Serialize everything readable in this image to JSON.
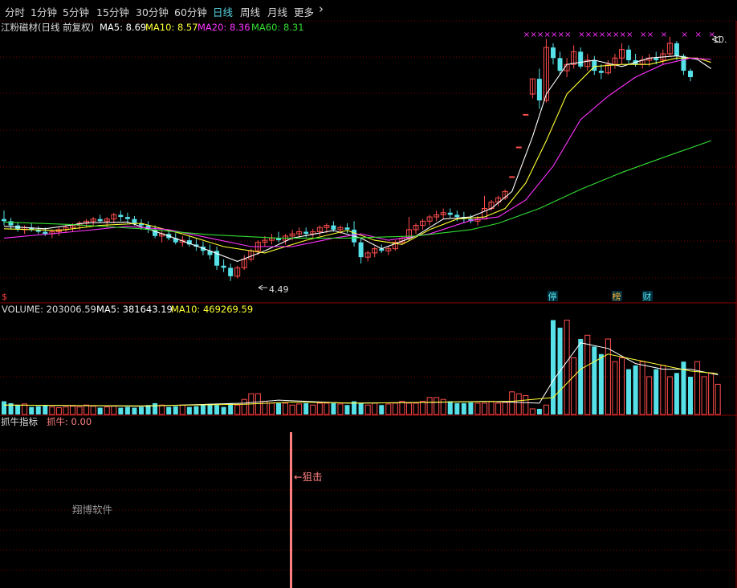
{
  "tabs": [
    {
      "label": "分时",
      "active": false
    },
    {
      "label": "1分钟",
      "active": false
    },
    {
      "label": "5分钟",
      "active": false
    },
    {
      "label": "15分钟",
      "active": false
    },
    {
      "label": "30分钟",
      "active": false
    },
    {
      "label": "60分钟",
      "active": false
    },
    {
      "label": "日线",
      "active": true
    },
    {
      "label": "周线",
      "active": false
    },
    {
      "label": "月线",
      "active": false
    },
    {
      "label": "更多",
      "active": false
    }
  ],
  "more_icon": "chevron-right-icon",
  "colors": {
    "background": "#000000",
    "grid": "#7a0000",
    "axis": "#8b0000",
    "up": "#ff4d4d",
    "down": "#56e0e8",
    "ma5": "#ffffff",
    "ma10": "#ffff33",
    "ma20": "#ff33ff",
    "ma60": "#33dd33",
    "marker": "#ff33ff",
    "signal": "#ff8080",
    "tab_active": "#57d7e3"
  },
  "price_panel": {
    "title": "江粉磁材(日线 前复权)",
    "ma_labels": [
      {
        "text": "MA5: 8.69",
        "color": "#ffffff"
      },
      {
        "text": "MA10: 8.57",
        "color": "#ffff33"
      },
      {
        "text": "MA20: 8.36",
        "color": "#ff33ff"
      },
      {
        "text": "MA60: 8.31",
        "color": "#33dd33"
      }
    ],
    "high_label": "10.",
    "low_label": "4.49",
    "corner_mark": "$",
    "badges": [
      {
        "text": "停",
        "color": "#56e0e8"
      },
      {
        "text": "榜",
        "color": "#ffb030"
      },
      {
        "text": "财",
        "color": "#56e0e8"
      }
    ]
  },
  "volume_panel": {
    "labels": [
      {
        "text": "VOLUME: 203006.59",
        "color": "#dddddd"
      },
      {
        "text": "MA5: 381643.19",
        "color": "#ffffff"
      },
      {
        "text": "MA10: 469269.59",
        "color": "#ffff33"
      }
    ]
  },
  "indicator_panel": {
    "labels": [
      {
        "text": "抓牛指标",
        "color": "#dddddd"
      },
      {
        "text": "抓牛: 0.00",
        "color": "#ff8080"
      }
    ],
    "signal_label": "←狙击",
    "watermark": "翔博软件"
  },
  "chart_data": {
    "type": "candlestick",
    "y_range": [
      4.2,
      10.4
    ],
    "low": 4.49,
    "high_label": "10.",
    "candles": [
      {
        "o": 5.95,
        "h": 6.15,
        "l": 5.8,
        "c": 5.9
      },
      {
        "o": 5.9,
        "h": 5.98,
        "l": 5.7,
        "c": 5.8
      },
      {
        "o": 5.8,
        "h": 5.88,
        "l": 5.65,
        "c": 5.7
      },
      {
        "o": 5.7,
        "h": 5.8,
        "l": 5.6,
        "c": 5.75
      },
      {
        "o": 5.75,
        "h": 5.85,
        "l": 5.65,
        "c": 5.7
      },
      {
        "o": 5.7,
        "h": 5.78,
        "l": 5.6,
        "c": 5.65
      },
      {
        "o": 5.65,
        "h": 5.75,
        "l": 5.55,
        "c": 5.6
      },
      {
        "o": 5.6,
        "h": 5.7,
        "l": 5.5,
        "c": 5.65
      },
      {
        "o": 5.65,
        "h": 5.75,
        "l": 5.55,
        "c": 5.7
      },
      {
        "o": 5.7,
        "h": 5.82,
        "l": 5.62,
        "c": 5.75
      },
      {
        "o": 5.75,
        "h": 5.85,
        "l": 5.66,
        "c": 5.8
      },
      {
        "o": 5.8,
        "h": 5.9,
        "l": 5.7,
        "c": 5.85
      },
      {
        "o": 5.85,
        "h": 5.95,
        "l": 5.75,
        "c": 5.9
      },
      {
        "o": 5.9,
        "h": 6.0,
        "l": 5.8,
        "c": 5.95
      },
      {
        "o": 5.95,
        "h": 6.05,
        "l": 5.85,
        "c": 5.9
      },
      {
        "o": 5.9,
        "h": 6.0,
        "l": 5.75,
        "c": 5.95
      },
      {
        "o": 5.95,
        "h": 6.1,
        "l": 5.85,
        "c": 6.05
      },
      {
        "o": 6.05,
        "h": 6.15,
        "l": 5.9,
        "c": 6.0
      },
      {
        "o": 6.0,
        "h": 6.1,
        "l": 5.85,
        "c": 5.95
      },
      {
        "o": 5.95,
        "h": 6.02,
        "l": 5.8,
        "c": 5.85
      },
      {
        "o": 5.85,
        "h": 5.95,
        "l": 5.7,
        "c": 5.8
      },
      {
        "o": 5.8,
        "h": 5.9,
        "l": 5.62,
        "c": 5.7
      },
      {
        "o": 5.7,
        "h": 5.8,
        "l": 5.5,
        "c": 5.55
      },
      {
        "o": 5.55,
        "h": 5.68,
        "l": 5.4,
        "c": 5.6
      },
      {
        "o": 5.6,
        "h": 5.7,
        "l": 5.45,
        "c": 5.5
      },
      {
        "o": 5.5,
        "h": 5.62,
        "l": 5.35,
        "c": 5.4
      },
      {
        "o": 5.4,
        "h": 5.55,
        "l": 5.3,
        "c": 5.45
      },
      {
        "o": 5.45,
        "h": 5.55,
        "l": 5.3,
        "c": 5.35
      },
      {
        "o": 5.35,
        "h": 5.48,
        "l": 5.2,
        "c": 5.3
      },
      {
        "o": 5.3,
        "h": 5.42,
        "l": 5.1,
        "c": 5.2
      },
      {
        "o": 5.2,
        "h": 5.35,
        "l": 5.0,
        "c": 5.1
      },
      {
        "o": 5.2,
        "h": 5.3,
        "l": 4.75,
        "c": 4.85
      },
      {
        "o": 4.85,
        "h": 5.0,
        "l": 4.7,
        "c": 4.8
      },
      {
        "o": 4.8,
        "h": 4.9,
        "l": 4.49,
        "c": 4.6
      },
      {
        "o": 4.6,
        "h": 4.85,
        "l": 4.55,
        "c": 4.8
      },
      {
        "o": 4.8,
        "h": 5.1,
        "l": 4.75,
        "c": 5.0
      },
      {
        "o": 5.0,
        "h": 5.25,
        "l": 4.95,
        "c": 5.2
      },
      {
        "o": 5.2,
        "h": 5.45,
        "l": 5.1,
        "c": 5.4
      },
      {
        "o": 5.4,
        "h": 5.55,
        "l": 5.3,
        "c": 5.45
      },
      {
        "o": 5.45,
        "h": 5.6,
        "l": 5.35,
        "c": 5.5
      },
      {
        "o": 5.5,
        "h": 5.65,
        "l": 5.4,
        "c": 5.45
      },
      {
        "o": 5.45,
        "h": 5.6,
        "l": 5.35,
        "c": 5.55
      },
      {
        "o": 5.55,
        "h": 5.7,
        "l": 5.45,
        "c": 5.6
      },
      {
        "o": 5.6,
        "h": 5.75,
        "l": 5.5,
        "c": 5.65
      },
      {
        "o": 5.65,
        "h": 5.75,
        "l": 5.52,
        "c": 5.6
      },
      {
        "o": 5.6,
        "h": 5.72,
        "l": 5.5,
        "c": 5.65
      },
      {
        "o": 5.65,
        "h": 5.8,
        "l": 5.55,
        "c": 5.75
      },
      {
        "o": 5.75,
        "h": 5.85,
        "l": 5.62,
        "c": 5.8
      },
      {
        "o": 5.8,
        "h": 5.9,
        "l": 5.65,
        "c": 5.7
      },
      {
        "o": 5.7,
        "h": 5.8,
        "l": 5.6,
        "c": 5.75
      },
      {
        "o": 5.75,
        "h": 5.85,
        "l": 5.62,
        "c": 5.7
      },
      {
        "o": 5.7,
        "h": 5.9,
        "l": 5.3,
        "c": 5.4
      },
      {
        "o": 5.4,
        "h": 5.5,
        "l": 4.9,
        "c": 5.05
      },
      {
        "o": 5.05,
        "h": 5.2,
        "l": 4.95,
        "c": 5.15
      },
      {
        "o": 5.15,
        "h": 5.3,
        "l": 5.05,
        "c": 5.25
      },
      {
        "o": 5.25,
        "h": 5.35,
        "l": 5.15,
        "c": 5.2
      },
      {
        "o": 5.2,
        "h": 5.32,
        "l": 5.1,
        "c": 5.25
      },
      {
        "o": 5.25,
        "h": 5.45,
        "l": 5.2,
        "c": 5.4
      },
      {
        "o": 5.4,
        "h": 5.55,
        "l": 5.35,
        "c": 5.5
      },
      {
        "o": 5.5,
        "h": 6.0,
        "l": 5.45,
        "c": 5.7
      },
      {
        "o": 5.7,
        "h": 5.85,
        "l": 5.6,
        "c": 5.8
      },
      {
        "o": 5.8,
        "h": 5.95,
        "l": 5.7,
        "c": 5.9
      },
      {
        "o": 5.9,
        "h": 6.05,
        "l": 5.8,
        "c": 6.0
      },
      {
        "o": 6.0,
        "h": 6.15,
        "l": 5.9,
        "c": 6.05
      },
      {
        "o": 6.05,
        "h": 6.2,
        "l": 5.95,
        "c": 6.1
      },
      {
        "o": 6.1,
        "h": 6.2,
        "l": 5.98,
        "c": 6.05
      },
      {
        "o": 6.05,
        "h": 6.15,
        "l": 5.9,
        "c": 6.0
      },
      {
        "o": 6.0,
        "h": 6.12,
        "l": 5.85,
        "c": 5.95
      },
      {
        "o": 5.95,
        "h": 6.05,
        "l": 5.85,
        "c": 5.9
      },
      {
        "o": 5.9,
        "h": 6.02,
        "l": 5.8,
        "c": 5.95
      },
      {
        "o": 5.95,
        "h": 6.5,
        "l": 6.15,
        "c": 6.2
      },
      {
        "o": 6.2,
        "h": 6.4,
        "l": 6.15,
        "c": 6.35
      },
      {
        "o": 6.35,
        "h": 6.5,
        "l": 6.25,
        "c": 6.45
      },
      {
        "o": 6.45,
        "h": 6.65,
        "l": 6.4,
        "c": 6.6
      },
      {
        "o": 6.95,
        "h": 6.96,
        "l": 6.94,
        "c": 6.95
      },
      {
        "o": 7.65,
        "h": 7.66,
        "l": 7.64,
        "c": 7.65
      },
      {
        "o": 8.42,
        "h": 8.43,
        "l": 8.41,
        "c": 8.42
      },
      {
        "o": 8.9,
        "h": 9.26,
        "l": 8.8,
        "c": 9.26
      },
      {
        "o": 9.26,
        "h": 9.5,
        "l": 8.55,
        "c": 8.75
      },
      {
        "o": 8.75,
        "h": 10.2,
        "l": 8.7,
        "c": 10.0
      },
      {
        "o": 10.0,
        "h": 10.1,
        "l": 9.6,
        "c": 9.75
      },
      {
        "o": 9.75,
        "h": 9.9,
        "l": 9.35,
        "c": 9.45
      },
      {
        "o": 9.45,
        "h": 9.75,
        "l": 9.3,
        "c": 9.6
      },
      {
        "o": 9.6,
        "h": 10.05,
        "l": 9.5,
        "c": 9.9
      },
      {
        "o": 9.9,
        "h": 10.0,
        "l": 9.5,
        "c": 9.55
      },
      {
        "o": 9.55,
        "h": 9.85,
        "l": 9.45,
        "c": 9.7
      },
      {
        "o": 9.7,
        "h": 9.8,
        "l": 9.35,
        "c": 9.45
      },
      {
        "o": 9.45,
        "h": 9.6,
        "l": 9.25,
        "c": 9.4
      },
      {
        "o": 9.4,
        "h": 9.7,
        "l": 9.35,
        "c": 9.6
      },
      {
        "o": 9.6,
        "h": 9.85,
        "l": 9.5,
        "c": 9.75
      },
      {
        "o": 9.75,
        "h": 10.1,
        "l": 9.6,
        "c": 9.95
      },
      {
        "o": 9.95,
        "h": 10.05,
        "l": 9.6,
        "c": 9.7
      },
      {
        "o": 9.7,
        "h": 9.85,
        "l": 9.55,
        "c": 9.6
      },
      {
        "o": 9.6,
        "h": 9.8,
        "l": 9.5,
        "c": 9.7
      },
      {
        "o": 9.7,
        "h": 9.85,
        "l": 9.55,
        "c": 9.75
      },
      {
        "o": 9.75,
        "h": 9.9,
        "l": 9.6,
        "c": 9.7
      },
      {
        "o": 9.7,
        "h": 9.95,
        "l": 9.6,
        "c": 9.85
      },
      {
        "o": 9.85,
        "h": 10.25,
        "l": 9.8,
        "c": 10.1
      },
      {
        "o": 10.1,
        "h": 10.15,
        "l": 9.7,
        "c": 9.8
      },
      {
        "o": 9.8,
        "h": 9.85,
        "l": 9.35,
        "c": 9.45
      },
      {
        "o": 9.45,
        "h": 9.5,
        "l": 9.2,
        "c": 9.3
      }
    ],
    "ma_lines": [
      {
        "name": "MA5",
        "color": "#ffffff",
        "values": [
          [
            0,
            5.78
          ],
          [
            6,
            5.72
          ],
          [
            12,
            5.86
          ],
          [
            18,
            5.88
          ],
          [
            24,
            5.55
          ],
          [
            30,
            5.2
          ],
          [
            34,
            4.95
          ],
          [
            38,
            5.2
          ],
          [
            42,
            5.5
          ],
          [
            48,
            5.68
          ],
          [
            52,
            5.5
          ],
          [
            55,
            5.25
          ],
          [
            60,
            5.55
          ],
          [
            64,
            5.95
          ],
          [
            68,
            6.0
          ],
          [
            71,
            6.2
          ],
          [
            74,
            6.6
          ],
          [
            77,
            7.9
          ],
          [
            79,
            8.9
          ],
          [
            82,
            9.6
          ],
          [
            86,
            9.7
          ],
          [
            90,
            9.55
          ],
          [
            94,
            9.75
          ],
          [
            98,
            9.8
          ],
          [
            101,
            9.72
          ],
          [
            103,
            9.5
          ]
        ]
      },
      {
        "name": "MA10",
        "color": "#ffff33",
        "values": [
          [
            0,
            5.72
          ],
          [
            8,
            5.68
          ],
          [
            14,
            5.8
          ],
          [
            20,
            5.85
          ],
          [
            26,
            5.6
          ],
          [
            32,
            5.3
          ],
          [
            38,
            5.15
          ],
          [
            44,
            5.45
          ],
          [
            50,
            5.68
          ],
          [
            54,
            5.45
          ],
          [
            58,
            5.35
          ],
          [
            62,
            5.7
          ],
          [
            66,
            5.95
          ],
          [
            70,
            6.0
          ],
          [
            73,
            6.2
          ],
          [
            76,
            6.8
          ],
          [
            79,
            7.8
          ],
          [
            82,
            8.9
          ],
          [
            86,
            9.55
          ],
          [
            90,
            9.6
          ],
          [
            94,
            9.6
          ],
          [
            98,
            9.75
          ],
          [
            101,
            9.75
          ],
          [
            103,
            9.65
          ]
        ]
      },
      {
        "name": "MA20",
        "color": "#ff33ff",
        "values": [
          [
            0,
            5.5
          ],
          [
            10,
            5.65
          ],
          [
            18,
            5.78
          ],
          [
            24,
            5.7
          ],
          [
            30,
            5.5
          ],
          [
            36,
            5.3
          ],
          [
            42,
            5.3
          ],
          [
            48,
            5.5
          ],
          [
            52,
            5.6
          ],
          [
            56,
            5.45
          ],
          [
            62,
            5.6
          ],
          [
            68,
            5.92
          ],
          [
            72,
            6.0
          ],
          [
            76,
            6.4
          ],
          [
            80,
            7.2
          ],
          [
            84,
            8.3
          ],
          [
            88,
            8.85
          ],
          [
            92,
            9.3
          ],
          [
            96,
            9.6
          ],
          [
            100,
            9.75
          ],
          [
            103,
            9.72
          ]
        ]
      },
      {
        "name": "MA60",
        "color": "#33dd33",
        "values": [
          [
            0,
            5.88
          ],
          [
            10,
            5.82
          ],
          [
            20,
            5.72
          ],
          [
            30,
            5.58
          ],
          [
            40,
            5.5
          ],
          [
            50,
            5.5
          ],
          [
            60,
            5.55
          ],
          [
            68,
            5.7
          ],
          [
            72,
            5.85
          ],
          [
            78,
            6.2
          ],
          [
            84,
            6.65
          ],
          [
            90,
            7.05
          ],
          [
            96,
            7.4
          ],
          [
            103,
            7.8
          ]
        ]
      }
    ],
    "volume": [
      0.35,
      0.3,
      0.25,
      0.28,
      0.2,
      0.22,
      0.25,
      0.2,
      0.18,
      0.2,
      0.22,
      0.2,
      0.25,
      0.22,
      0.18,
      0.2,
      0.22,
      0.18,
      0.2,
      0.18,
      0.2,
      0.25,
      0.3,
      0.25,
      0.2,
      0.22,
      0.25,
      0.2,
      0.22,
      0.25,
      0.28,
      0.25,
      0.2,
      0.3,
      0.25,
      0.4,
      0.55,
      0.55,
      0.35,
      0.3,
      0.3,
      0.3,
      0.25,
      0.28,
      0.3,
      0.25,
      0.3,
      0.3,
      0.3,
      0.28,
      0.25,
      0.35,
      0.3,
      0.25,
      0.3,
      0.25,
      0.28,
      0.3,
      0.35,
      0.3,
      0.3,
      0.35,
      0.45,
      0.45,
      0.4,
      0.35,
      0.3,
      0.3,
      0.32,
      0.3,
      0.3,
      0.35,
      0.3,
      0.32,
      0.6,
      0.55,
      0.5,
      0.15,
      0.15,
      0.25,
      2.5,
      2.3,
      2.5,
      1.5,
      2.0,
      2.1,
      1.8,
      1.6,
      2.0,
      1.4,
      1.5,
      1.2,
      1.3,
      1.4,
      1.0,
      1.2,
      1.3,
      1.0,
      1.1,
      1.4,
      1.0,
      1.4,
      1.0,
      1.1,
      0.8
    ],
    "vol_ma5": [
      [
        0,
        0.25
      ],
      [
        20,
        0.22
      ],
      [
        35,
        0.3
      ],
      [
        40,
        0.38
      ],
      [
        50,
        0.3
      ],
      [
        62,
        0.32
      ],
      [
        70,
        0.35
      ],
      [
        78,
        0.3
      ],
      [
        80,
        0.9
      ],
      [
        84,
        1.9
      ],
      [
        88,
        1.75
      ],
      [
        92,
        1.35
      ],
      [
        96,
        1.2
      ],
      [
        100,
        1.2
      ],
      [
        104,
        1.05
      ]
    ],
    "vol_ma10": [
      [
        0,
        0.25
      ],
      [
        20,
        0.23
      ],
      [
        35,
        0.27
      ],
      [
        42,
        0.33
      ],
      [
        52,
        0.3
      ],
      [
        64,
        0.33
      ],
      [
        74,
        0.35
      ],
      [
        80,
        0.45
      ],
      [
        84,
        1.2
      ],
      [
        88,
        1.6
      ],
      [
        92,
        1.45
      ],
      [
        96,
        1.3
      ],
      [
        100,
        1.15
      ],
      [
        104,
        1.08
      ]
    ],
    "markers_top": [
      76,
      77,
      78,
      79,
      80,
      81,
      82,
      84,
      85,
      86,
      87,
      88,
      89,
      90,
      91,
      93,
      94,
      96,
      99,
      101,
      103
    ],
    "indicator": {
      "name": "抓牛",
      "signal_index": 35,
      "signal_value": 1,
      "last": 0.0
    }
  }
}
